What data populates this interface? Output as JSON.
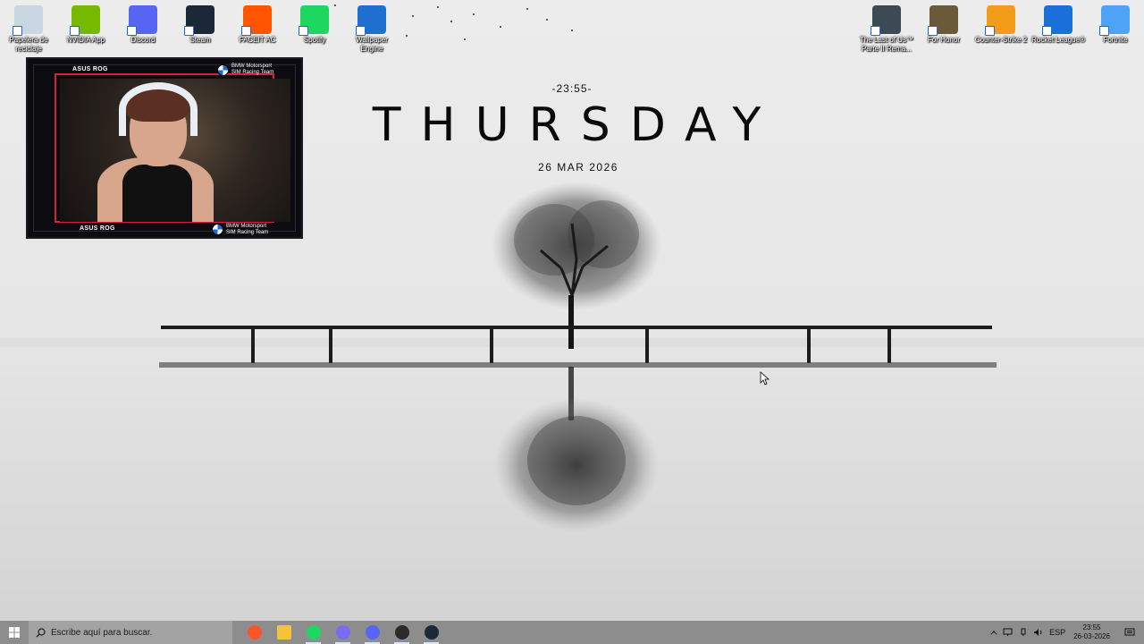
{
  "desktop": {
    "icons_left": [
      {
        "name": "recycle-bin-icon",
        "label": "Papelera de reciclaje",
        "color": "#c9d6e3"
      },
      {
        "name": "nvidia-app-icon",
        "label": "NVIDIA App",
        "color": "#76b900"
      },
      {
        "name": "discord-icon",
        "label": "Discord",
        "color": "#5865f2"
      },
      {
        "name": "steam-icon",
        "label": "Steam",
        "color": "#1b2838"
      },
      {
        "name": "faceit-ac-icon",
        "label": "FACEIT AC",
        "color": "#ff5500"
      },
      {
        "name": "spotify-icon",
        "label": "Spotify",
        "color": "#1ed760"
      },
      {
        "name": "wallpaper-engine-icon",
        "label": "Wallpaper Engine",
        "color": "#1f6fd1"
      }
    ],
    "icons_right": [
      {
        "name": "the-last-of-us-icon",
        "label": "The Last of Us™ Parte II Rema...",
        "color": "#3c4a55"
      },
      {
        "name": "for-honor-icon",
        "label": "For Honor",
        "color": "#6b5a3a"
      },
      {
        "name": "counter-strike-2-icon",
        "label": "Counter-Strike 2",
        "color": "#f39b1b"
      },
      {
        "name": "rocket-league-icon",
        "label": "Rocket League®",
        "color": "#1b6fd9"
      },
      {
        "name": "fortnite-icon",
        "label": "Fortnite",
        "color": "#4fa3f7"
      }
    ]
  },
  "webcam": {
    "brand_top": "ASUS ROG",
    "brand_bottom": "ASUS ROG",
    "sponsor_top_line1": "BMW Motorsport",
    "sponsor_top_line2": "SIM Racing Team",
    "sponsor_bottom_line1": "BMW Motorsport",
    "sponsor_bottom_line2": "SIM Racing Team",
    "accent": "#d1233a"
  },
  "clock_widget": {
    "time": "-23:55-",
    "day": "THURSDAY",
    "date": "26 MAR 2026"
  },
  "taskbar": {
    "search_placeholder": "Escribe aquí para buscar.",
    "apps": [
      {
        "name": "brave-icon",
        "color": "#fb542b"
      },
      {
        "name": "file-explorer-icon",
        "color": "#f3c43a"
      },
      {
        "name": "spotify-taskbar-icon",
        "color": "#1ed760"
      },
      {
        "name": "gaming-app-icon",
        "color": "#7a6cf0"
      },
      {
        "name": "discord-taskbar-icon",
        "color": "#5865f2"
      },
      {
        "name": "obs-icon",
        "color": "#2b2b2b"
      },
      {
        "name": "steam-taskbar-icon",
        "color": "#1b2838"
      }
    ],
    "tray": {
      "language": "ESP",
      "clock_time": "23:55",
      "clock_date": "26-03-2026"
    }
  }
}
